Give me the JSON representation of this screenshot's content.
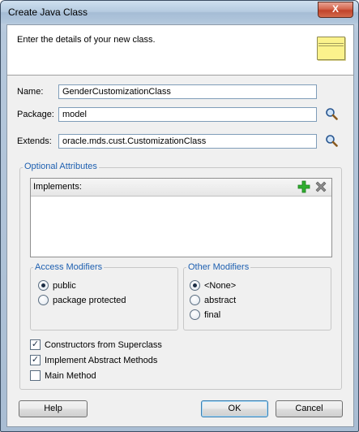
{
  "window": {
    "title": "Create Java Class",
    "close_label": "X"
  },
  "header": {
    "instruction": "Enter the details of your new class."
  },
  "form": {
    "name_label": "Name:",
    "name_value": "GenderCustomizationClass",
    "package_label": "Package:",
    "package_value": "model",
    "extends_label": "Extends:",
    "extends_value": "oracle.mds.cust.CustomizationClass"
  },
  "optional": {
    "title": "Optional Attributes",
    "implements_label": "Implements:",
    "access": {
      "title": "Access Modifiers",
      "options": [
        {
          "label": "public",
          "selected": true
        },
        {
          "label": "package protected",
          "selected": false
        }
      ]
    },
    "other": {
      "title": "Other Modifiers",
      "options": [
        {
          "label": "<None>",
          "selected": true
        },
        {
          "label": "abstract",
          "selected": false
        },
        {
          "label": "final",
          "selected": false
        }
      ]
    },
    "checks": [
      {
        "label": "Constructors from Superclass",
        "checked": true
      },
      {
        "label": "Implement Abstract Methods",
        "checked": true
      },
      {
        "label": "Main Method",
        "checked": false
      }
    ]
  },
  "buttons": {
    "help": "Help",
    "ok": "OK",
    "cancel": "Cancel"
  },
  "colors": {
    "group_title": "#1d5fb0",
    "add_icon": "#2fae2f",
    "remove_icon": "#6b6b6b"
  }
}
